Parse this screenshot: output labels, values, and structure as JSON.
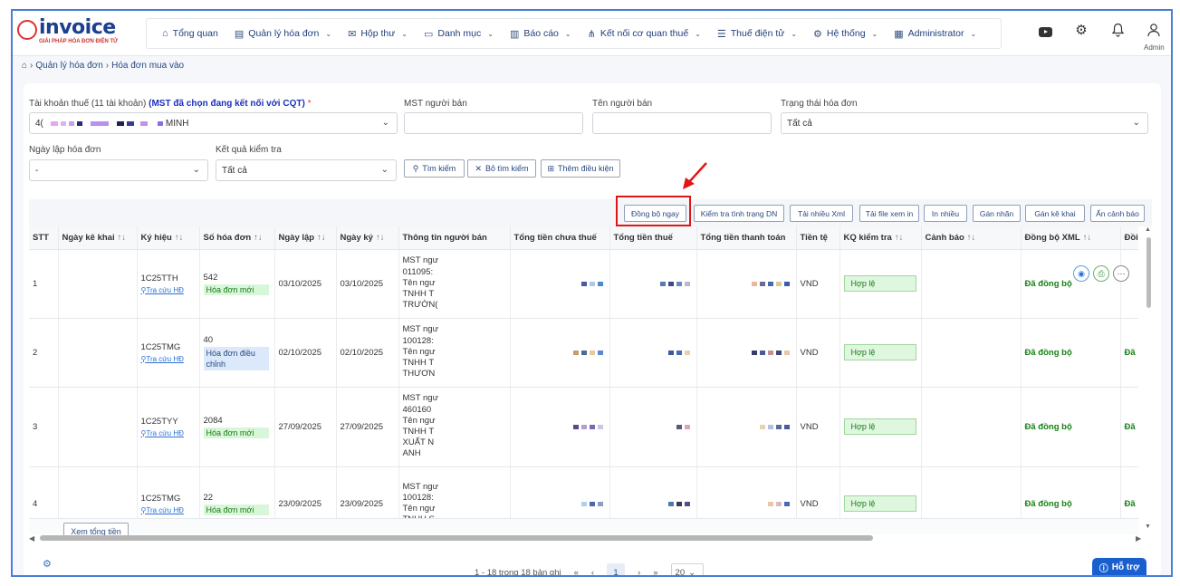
{
  "logo": {
    "text": "invoice",
    "tagline": "GIẢI PHÁP HÓA ĐƠN ĐIỆN TỬ"
  },
  "menu": [
    {
      "label": "Tổng quan",
      "icon": "home-icon",
      "glyph": "⌂",
      "chev": false
    },
    {
      "label": "Quản lý hóa đơn",
      "icon": "document-icon",
      "glyph": "▤",
      "chev": true
    },
    {
      "label": "Hộp thư",
      "icon": "mail-icon",
      "glyph": "✉",
      "chev": true
    },
    {
      "label": "Danh mục",
      "icon": "folder-icon",
      "glyph": "▭",
      "chev": true
    },
    {
      "label": "Báo cáo",
      "icon": "chart-icon",
      "glyph": "▥",
      "chev": true
    },
    {
      "label": "Kết nối cơ quan thuế",
      "icon": "share-icon",
      "glyph": "⋔",
      "chev": true
    },
    {
      "label": "Thuế điện tử",
      "icon": "list-icon",
      "glyph": "☰",
      "chev": true
    },
    {
      "label": "Hệ thống",
      "icon": "settings-icon",
      "glyph": "⚙",
      "chev": true
    },
    {
      "label": "Administrator",
      "icon": "table-icon",
      "glyph": "▦",
      "chev": true
    }
  ],
  "user": {
    "label": "Admin"
  },
  "breadcrumb": {
    "item1": "Quản lý hóa đơn",
    "item2": "Hóa đơn mua vào"
  },
  "filters": {
    "tax_account_label": "Tài khoản thuế (11 tài khoản)",
    "tax_account_note": "(MST đã chọn đang kết nối với CQT)",
    "required": "*",
    "tax_account_prefix": "4(",
    "tax_account_suffix": "MINH",
    "seller_tax_label": "MST người bán",
    "seller_name_label": "Tên người bán",
    "status_label": "Trạng thái hóa đơn",
    "status_value": "Tất cả",
    "date_label": "Ngày lập hóa đơn",
    "date_value": "-",
    "check_label": "Kết quả kiểm tra",
    "check_value": "Tất cả",
    "search_btn": "Tìm kiếm",
    "clear_btn": "Bỏ tìm kiếm",
    "more_btn": "Thêm điều kiện"
  },
  "toolbar": {
    "sync": "Đồng bộ ngay",
    "check_status": "Kiểm tra tình trạng DN",
    "download_xml": "Tải nhiều Xml",
    "download_view": "Tải file xem in",
    "print_many": "In nhiều",
    "assign_label": "Gán nhãn",
    "assign_declare": "Gán kê khai",
    "hide_warning": "Ẩn cảnh báo"
  },
  "columns": [
    "STT",
    "Ngày kê khai",
    "Ký hiệu",
    "Số hóa đơn",
    "Ngày lập",
    "Ngày ký",
    "Thông tin người bán",
    "Tổng tiền chưa thuế",
    "Tổng tiền thuế",
    "Tổng tiền thanh toán",
    "Tiền tệ",
    "KQ kiểm tra",
    "Cảnh báo",
    "Đồng bộ XML",
    "Đồi"
  ],
  "lookup_text": "Tra cứu HĐ",
  "rows": [
    {
      "stt": "1",
      "symbol": "1C25TTH",
      "number": "542",
      "status": "Hóa đơn mới",
      "status_type": "new",
      "created": "03/10/2025",
      "signed": "03/10/2025",
      "seller": [
        "MST ngư",
        "011095:",
        "Tên ngư",
        "TNHH T",
        "TRƯỜN("
      ],
      "currency": "VND",
      "result": "Hợp lệ",
      "sync": "Đã đồng bộ",
      "sync2": ""
    },
    {
      "stt": "2",
      "symbol": "1C25TMG",
      "number": "40",
      "status": "Hóa đơn điều chỉnh",
      "status_type": "adj",
      "created": "02/10/2025",
      "signed": "02/10/2025",
      "seller": [
        "MST ngư",
        "100128:",
        "Tên ngư",
        "TNHH T",
        "THƯƠN"
      ],
      "currency": "VND",
      "result": "Hợp lệ",
      "sync": "Đã đồng bộ",
      "sync2": "Đã"
    },
    {
      "stt": "3",
      "symbol": "1C25TYY",
      "number": "2084",
      "status": "Hóa đơn mới",
      "status_type": "new",
      "created": "27/09/2025",
      "signed": "27/09/2025",
      "seller": [
        "MST ngư",
        "460160",
        "Tên ngư",
        "TNHH T",
        "XUẤT N",
        "ANH"
      ],
      "currency": "VND",
      "result": "Hợp lệ",
      "sync": "Đã đồng bộ",
      "sync2": "Đã"
    },
    {
      "stt": "4",
      "symbol": "1C25TMG",
      "number": "22",
      "status": "Hóa đơn mới",
      "status_type": "new",
      "created": "23/09/2025",
      "signed": "23/09/2025",
      "seller": [
        "MST ngư",
        "100128:",
        "Tên ngư",
        "TNHH S..."
      ],
      "currency": "VND",
      "result": "Hợp lệ",
      "sync": "Đã đồng bộ",
      "sync2": "Đã"
    }
  ],
  "footer": {
    "total_btn": "Xem tổng tiền"
  },
  "pagination": {
    "summary": "1 - 18 trong 18 bản ghi",
    "first": "«",
    "prev": "‹",
    "current": "1",
    "next": "›",
    "last": "»",
    "page_size": "20"
  },
  "support": {
    "label": "Hỗ trợ"
  },
  "colors": {
    "accent": "#1a5fd0",
    "highlight": "#e01515",
    "valid": "#1a7a1a"
  }
}
